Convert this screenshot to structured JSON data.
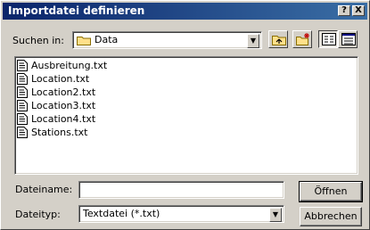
{
  "window": {
    "title": "Importdatei definieren",
    "help_label": "?",
    "close_label": "X"
  },
  "lookin": {
    "label": "Suchen in:",
    "folder": "Data"
  },
  "files": [
    {
      "name": "Ausbreitung.txt"
    },
    {
      "name": "Location.txt"
    },
    {
      "name": "Location2.txt"
    },
    {
      "name": "Location3.txt"
    },
    {
      "name": "Location4.txt"
    },
    {
      "name": "Stations.txt"
    }
  ],
  "filename": {
    "label": "Dateiname:",
    "value": ""
  },
  "filetype": {
    "label": "Dateityp:",
    "value": "Textdatei (*.txt)"
  },
  "buttons": {
    "open": "Öffnen",
    "cancel": "Abbrechen"
  }
}
